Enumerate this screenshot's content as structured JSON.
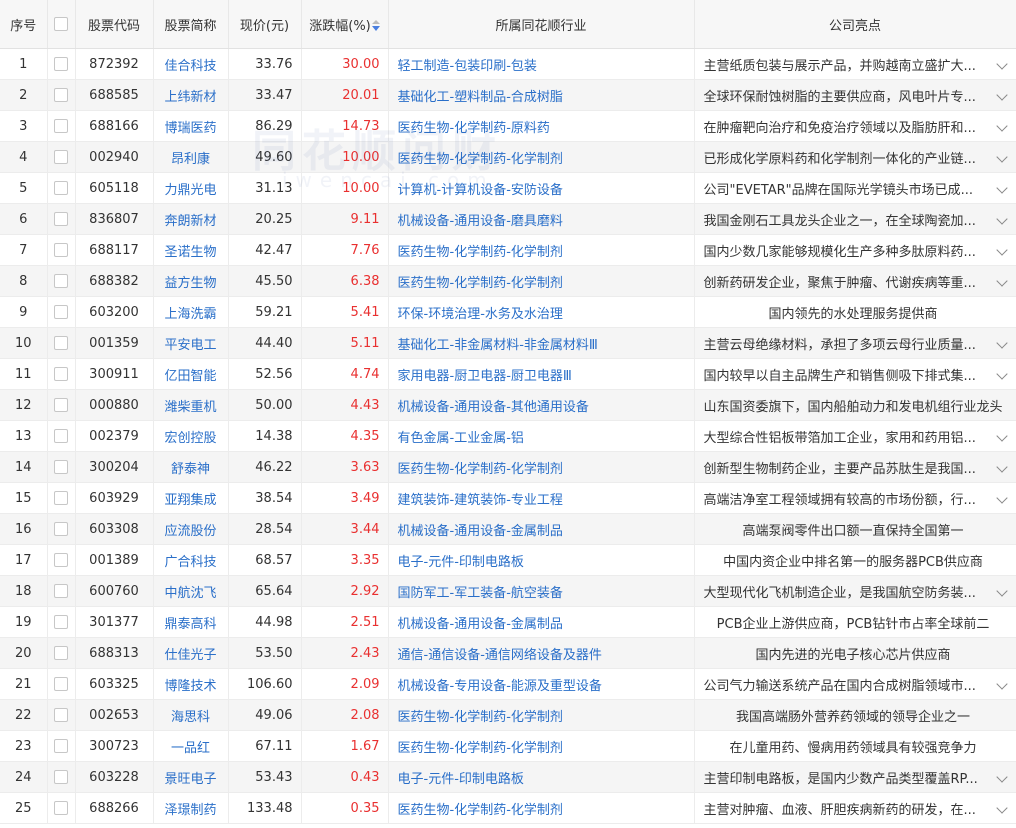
{
  "header": {
    "seq": "序号",
    "code": "股票代码",
    "name": "股票简称",
    "price": "现价(元)",
    "change": "涨跌幅(%)",
    "industry": "所属同花顺行业",
    "highlight": "公司亮点"
  },
  "watermark": {
    "line1": "同花顺问财",
    "line2": "iwencai.com"
  },
  "rows": [
    {
      "seq": "1",
      "code": "872392",
      "name": "佳合科技",
      "price": "33.76",
      "change": "30.00",
      "industry": "轻工制造-包装印刷-包装",
      "highlight": "主营纸质包装与展示产品，并购越南立盛扩大...",
      "expand": true
    },
    {
      "seq": "2",
      "code": "688585",
      "name": "上纬新材",
      "price": "33.47",
      "change": "20.01",
      "industry": "基础化工-塑料制品-合成树脂",
      "highlight": "全球环保耐蚀树脂的主要供应商，风电叶片专...",
      "expand": true
    },
    {
      "seq": "3",
      "code": "688166",
      "name": "博瑞医药",
      "price": "86.29",
      "change": "14.73",
      "industry": "医药生物-化学制药-原料药",
      "highlight": "在肿瘤靶向治疗和免疫治疗领域以及脂肪肝和...",
      "expand": true
    },
    {
      "seq": "4",
      "code": "002940",
      "name": "昂利康",
      "price": "49.60",
      "change": "10.00",
      "industry": "医药生物-化学制药-化学制剂",
      "highlight": "已形成化学原料药和化学制剂一体化的产业链...",
      "expand": true
    },
    {
      "seq": "5",
      "code": "605118",
      "name": "力鼎光电",
      "price": "31.13",
      "change": "10.00",
      "industry": "计算机-计算机设备-安防设备",
      "highlight": "公司\"EVETAR\"品牌在国际光学镜头市场已成...",
      "expand": true
    },
    {
      "seq": "6",
      "code": "836807",
      "name": "奔朗新材",
      "price": "20.25",
      "change": "9.11",
      "industry": "机械设备-通用设备-磨具磨料",
      "highlight": "我国金刚石工具龙头企业之一，在全球陶瓷加...",
      "expand": true
    },
    {
      "seq": "7",
      "code": "688117",
      "name": "圣诺生物",
      "price": "42.47",
      "change": "7.76",
      "industry": "医药生物-化学制药-化学制剂",
      "highlight": "国内少数几家能够规模化生产多种多肽原料药...",
      "expand": true
    },
    {
      "seq": "8",
      "code": "688382",
      "name": "益方生物",
      "price": "45.50",
      "change": "6.38",
      "industry": "医药生物-化学制药-化学制剂",
      "highlight": "创新药研发企业，聚焦于肿瘤、代谢疾病等重...",
      "expand": true
    },
    {
      "seq": "9",
      "code": "603200",
      "name": "上海洗霸",
      "price": "59.21",
      "change": "5.41",
      "industry": "环保-环境治理-水务及水治理",
      "highlight": "国内领先的水处理服务提供商",
      "expand": false
    },
    {
      "seq": "10",
      "code": "001359",
      "name": "平安电工",
      "price": "44.40",
      "change": "5.11",
      "industry": "基础化工-非金属材料-非金属材料Ⅲ",
      "highlight": "主营云母绝缘材料，承担了多项云母行业质量...",
      "expand": true
    },
    {
      "seq": "11",
      "code": "300911",
      "name": "亿田智能",
      "price": "52.56",
      "change": "4.74",
      "industry": "家用电器-厨卫电器-厨卫电器Ⅲ",
      "highlight": "国内较早以自主品牌生产和销售侧吸下排式集...",
      "expand": true
    },
    {
      "seq": "12",
      "code": "000880",
      "name": "潍柴重机",
      "price": "50.00",
      "change": "4.43",
      "industry": "机械设备-通用设备-其他通用设备",
      "highlight": "山东国资委旗下，国内船舶动力和发电机组行业龙头",
      "expand": false
    },
    {
      "seq": "13",
      "code": "002379",
      "name": "宏创控股",
      "price": "14.38",
      "change": "4.35",
      "industry": "有色金属-工业金属-铝",
      "highlight": "大型综合性铝板带箔加工企业，家用和药用铝...",
      "expand": true
    },
    {
      "seq": "14",
      "code": "300204",
      "name": "舒泰神",
      "price": "46.22",
      "change": "3.63",
      "industry": "医药生物-化学制药-化学制剂",
      "highlight": "创新型生物制药企业，主要产品苏肽生是我国...",
      "expand": true
    },
    {
      "seq": "15",
      "code": "603929",
      "name": "亚翔集成",
      "price": "38.54",
      "change": "3.49",
      "industry": "建筑装饰-建筑装饰-专业工程",
      "highlight": "高端洁净室工程领域拥有较高的市场份额，行...",
      "expand": true
    },
    {
      "seq": "16",
      "code": "603308",
      "name": "应流股份",
      "price": "28.54",
      "change": "3.44",
      "industry": "机械设备-通用设备-金属制品",
      "highlight": "高端泵阀零件出口额一直保持全国第一",
      "expand": false
    },
    {
      "seq": "17",
      "code": "001389",
      "name": "广合科技",
      "price": "68.57",
      "change": "3.35",
      "industry": "电子-元件-印制电路板",
      "highlight": "中国内资企业中排名第一的服务器PCB供应商",
      "expand": false
    },
    {
      "seq": "18",
      "code": "600760",
      "name": "中航沈飞",
      "price": "65.64",
      "change": "2.92",
      "industry": "国防军工-军工装备-航空装备",
      "highlight": "大型现代化飞机制造企业，是我国航空防务装...",
      "expand": true
    },
    {
      "seq": "19",
      "code": "301377",
      "name": "鼎泰高科",
      "price": "44.98",
      "change": "2.51",
      "industry": "机械设备-通用设备-金属制品",
      "highlight": "PCB企业上游供应商，PCB钻针市占率全球前二",
      "expand": false
    },
    {
      "seq": "20",
      "code": "688313",
      "name": "仕佳光子",
      "price": "53.50",
      "change": "2.43",
      "industry": "通信-通信设备-通信网络设备及器件",
      "highlight": "国内先进的光电子核心芯片供应商",
      "expand": false
    },
    {
      "seq": "21",
      "code": "603325",
      "name": "博隆技术",
      "price": "106.60",
      "change": "2.09",
      "industry": "机械设备-专用设备-能源及重型设备",
      "highlight": "公司气力输送系统产品在国内合成树脂领域市...",
      "expand": true
    },
    {
      "seq": "22",
      "code": "002653",
      "name": "海思科",
      "price": "49.06",
      "change": "2.08",
      "industry": "医药生物-化学制药-化学制剂",
      "highlight": "我国高端肠外营养药领域的领导企业之一",
      "expand": false
    },
    {
      "seq": "23",
      "code": "300723",
      "name": "一品红",
      "price": "67.11",
      "change": "1.67",
      "industry": "医药生物-化学制药-化学制剂",
      "highlight": "在儿童用药、慢病用药领域具有较强竞争力",
      "expand": false
    },
    {
      "seq": "24",
      "code": "603228",
      "name": "景旺电子",
      "price": "53.43",
      "change": "0.43",
      "industry": "电子-元件-印制电路板",
      "highlight": "主营印制电路板，是国内少数产品类型覆盖RP...",
      "expand": true
    },
    {
      "seq": "25",
      "code": "688266",
      "name": "泽璟制药",
      "price": "133.48",
      "change": "0.35",
      "industry": "医药生物-化学制药-化学制剂",
      "highlight": "主营对肿瘤、血液、肝胆疾病新药的研发，在...",
      "expand": true
    }
  ],
  "colors": {
    "up": "#e93030",
    "link": "#2a6fc9",
    "sort_active": "#4a7fe0"
  }
}
